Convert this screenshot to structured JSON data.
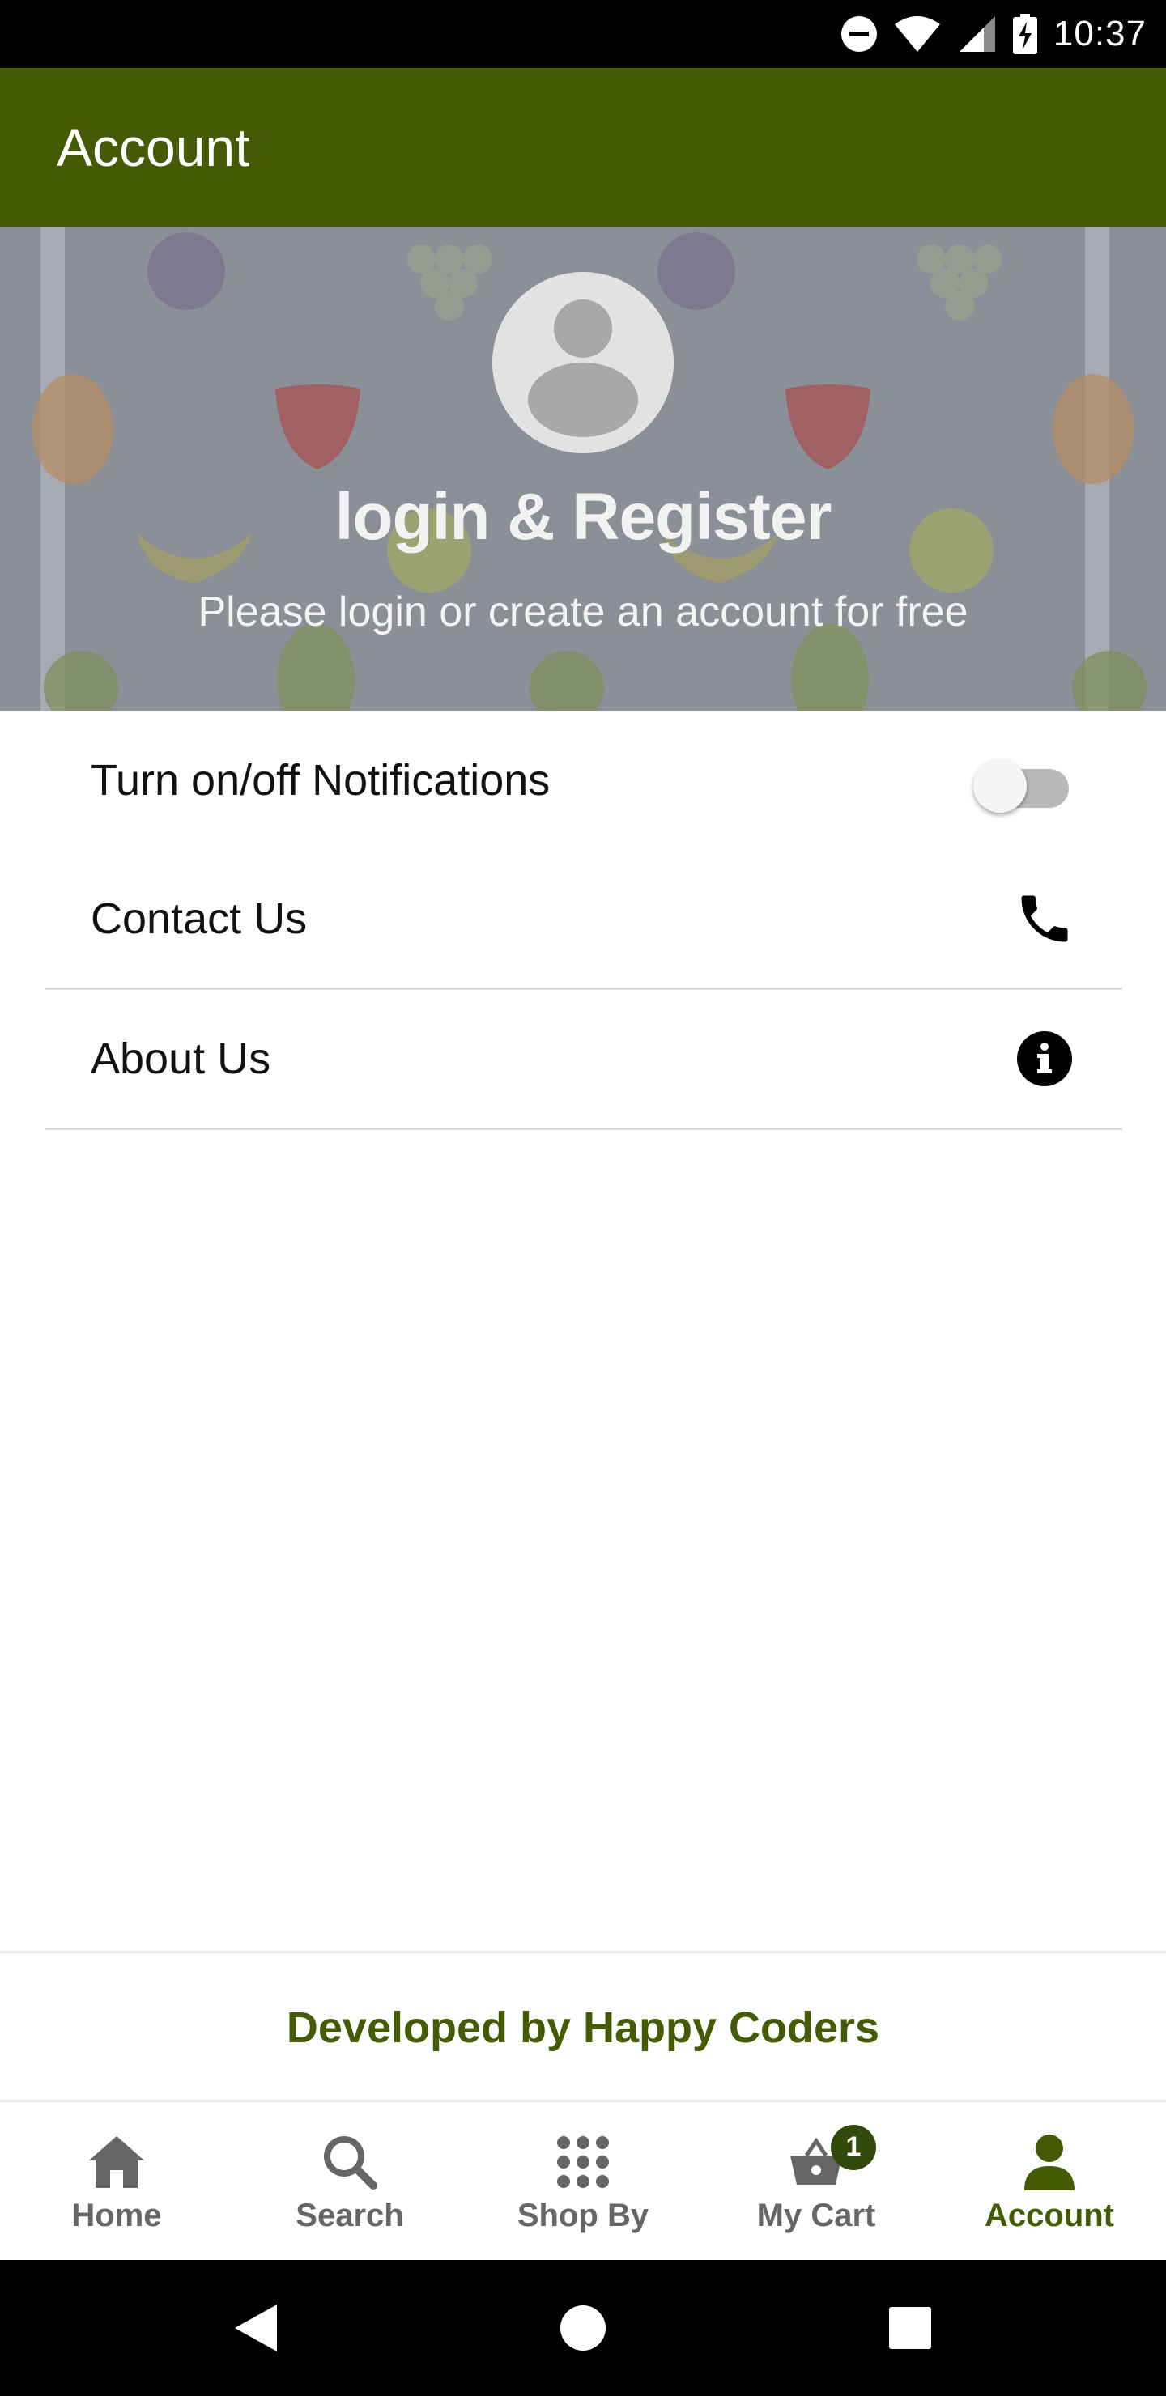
{
  "status_bar": {
    "time": "10:37",
    "icons": [
      "do-not-disturb-icon",
      "wifi-icon",
      "signal-icon",
      "battery-charging-icon"
    ]
  },
  "app_bar": {
    "title": "Account"
  },
  "header": {
    "avatar_icon": "person-avatar-icon",
    "headline": "login & Register",
    "subtitle": "Please login or create an account for free"
  },
  "settings": {
    "notifications": {
      "label": "Turn on/off Notifications",
      "enabled": false
    },
    "contact": {
      "label": "Contact Us",
      "icon": "phone-icon"
    },
    "about": {
      "label": "About Us",
      "icon": "info-icon"
    }
  },
  "footer": {
    "credit": "Developed by Happy Coders"
  },
  "bottom_nav": {
    "items": [
      {
        "label": "Home",
        "icon": "home-icon"
      },
      {
        "label": "Search",
        "icon": "search-icon"
      },
      {
        "label": "Shop By",
        "icon": "grid-icon"
      },
      {
        "label": "My Cart",
        "icon": "basket-icon",
        "badge": "1"
      },
      {
        "label": "Account",
        "icon": "person-icon"
      }
    ],
    "active": "Account"
  },
  "colors": {
    "brand_green": "#445a03",
    "banner_gray": "#8b8f98",
    "badge_green": "#2f4a0a"
  }
}
